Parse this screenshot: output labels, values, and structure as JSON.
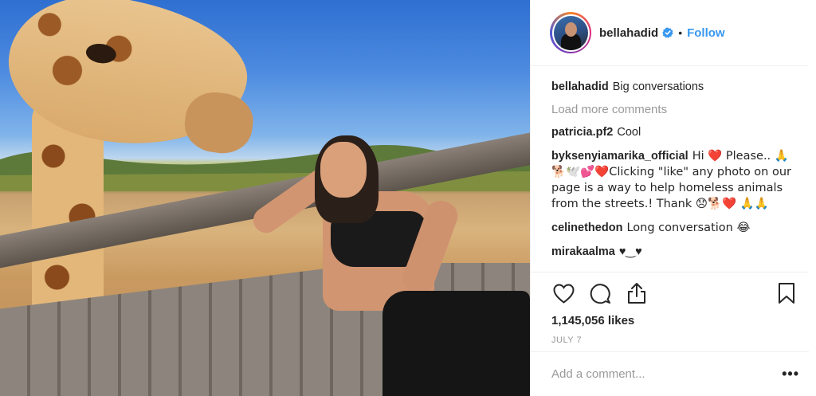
{
  "post": {
    "author": "bellahadid",
    "follow_label": "Follow",
    "separator": "•",
    "verified_icon": "verified-badge-icon"
  },
  "comments_section": {
    "load_more_label": "Load more comments",
    "items": [
      {
        "user": "bellahadid",
        "text": "Big conversations"
      },
      {
        "user": "patricia.pf2",
        "text": "Cool"
      },
      {
        "user": "byksenyiamarika_official",
        "text": "Hi ❤️ Please.. 🙏🐕🕊️💕❤️Clicking \"like\" any photo on our page is a way to help homeless animals from the streets.! Thank 😞🐕❤️ 🙏🙏"
      },
      {
        "user": "celinethedon",
        "text": "Long conversation 😂"
      },
      {
        "user": "mirakaalma",
        "text": "♥‿♥"
      }
    ]
  },
  "actions": {
    "like_icon": "heart-icon",
    "comment_icon": "comment-bubble-icon",
    "share_icon": "share-icon",
    "save_icon": "bookmark-icon"
  },
  "stats": {
    "likes_label": "1,145,056 likes",
    "date": "JULY 7"
  },
  "composer": {
    "placeholder": "Add a comment...",
    "more_label": "•••"
  },
  "colors": {
    "link": "#3897f0",
    "muted": "#999999",
    "text": "#262626",
    "border": "#efefef"
  }
}
